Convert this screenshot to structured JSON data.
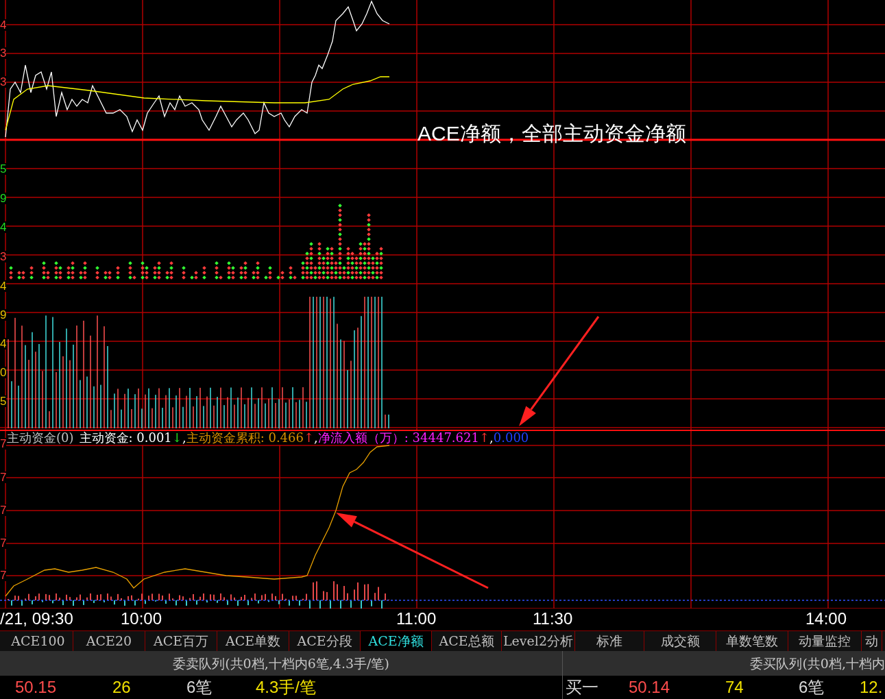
{
  "axis_labels": [
    {
      "text": "4",
      "color": "#ff3b3b"
    },
    {
      "text": "3",
      "color": "#ff3b3b"
    },
    {
      "text": "3",
      "color": "#ff3b3b"
    },
    {
      "text": "5",
      "color": "#22dd22"
    },
    {
      "text": "9",
      "color": "#22dd22"
    },
    {
      "text": "4",
      "color": "#22dd22"
    },
    {
      "text": "3",
      "color": "#ff3b3b"
    },
    {
      "text": "4",
      "color": "#e8c000"
    },
    {
      "text": "9",
      "color": "#e8c000"
    },
    {
      "text": "4",
      "color": "#e8c000"
    },
    {
      "text": "0",
      "color": "#e8c000"
    },
    {
      "text": "5",
      "color": "#e8c000"
    },
    {
      "text": "7",
      "color": "#ff3b3b"
    },
    {
      "text": "7",
      "color": "#ff3b3b"
    },
    {
      "text": "7",
      "color": "#ff3b3b"
    },
    {
      "text": "7",
      "color": "#ff3b3b"
    },
    {
      "text": "7",
      "color": "#ff3b3b"
    }
  ],
  "annotation": "ACE净额，全部主动资金净额",
  "legend": [
    {
      "kind": "title",
      "text": "主动资金(0)"
    },
    {
      "kind": "white",
      "text": "主动资金: 0.001"
    },
    {
      "kind": "down",
      "text": "↓"
    },
    {
      "kind": "sep",
      "text": ","
    },
    {
      "kind": "orange",
      "text": "主动资金累积: 0.466"
    },
    {
      "kind": "up",
      "text": "↑"
    },
    {
      "kind": "sep",
      "text": ","
    },
    {
      "kind": "magenta",
      "text": "净流入额（万）: 34447.621"
    },
    {
      "kind": "up",
      "text": "↑"
    },
    {
      "kind": "sep",
      "text": ","
    },
    {
      "kind": "blue",
      "text": "0.000"
    }
  ],
  "time_axis": [
    "/21, 09:30",
    "10:00",
    "11:00",
    "11:30",
    "14:00"
  ],
  "tabs": [
    {
      "label": "ACE100",
      "selected": false
    },
    {
      "label": "ACE20",
      "selected": false
    },
    {
      "label": "ACE百万",
      "selected": false
    },
    {
      "label": "ACE单数",
      "selected": false
    },
    {
      "label": "ACE分段",
      "selected": false
    },
    {
      "label": "ACE净额",
      "selected": true
    },
    {
      "label": "ACE总额",
      "selected": false
    },
    {
      "label": "Level2分析",
      "selected": false
    },
    {
      "label": "标准",
      "selected": false
    },
    {
      "label": "成交额",
      "selected": false
    },
    {
      "label": "单数笔数",
      "selected": false
    },
    {
      "label": "动量监控",
      "selected": false
    },
    {
      "label": "动",
      "selected": false
    }
  ],
  "sell_queue": {
    "title": "委卖队列(共0档,十档内6笔,4.3手/笔)",
    "cells": [
      {
        "text": "50.15",
        "color": "#ff4d4d"
      },
      {
        "text": "26",
        "color": "#f0e000"
      },
      {
        "text": "6笔",
        "color": "#d8d8d8"
      },
      {
        "text": "4.3手/笔",
        "color": "#f0e000"
      }
    ]
  },
  "buy_queue": {
    "title": "委买队列(共0档,十档内",
    "cells": [
      {
        "text": "买一",
        "color": "#d8d8d8"
      },
      {
        "text": "50.14",
        "color": "#ff4d4d"
      },
      {
        "text": "74",
        "color": "#f0e000"
      },
      {
        "text": "6笔",
        "color": "#d8d8d8"
      },
      {
        "text": "12.",
        "color": "#f0e000"
      }
    ]
  }
}
